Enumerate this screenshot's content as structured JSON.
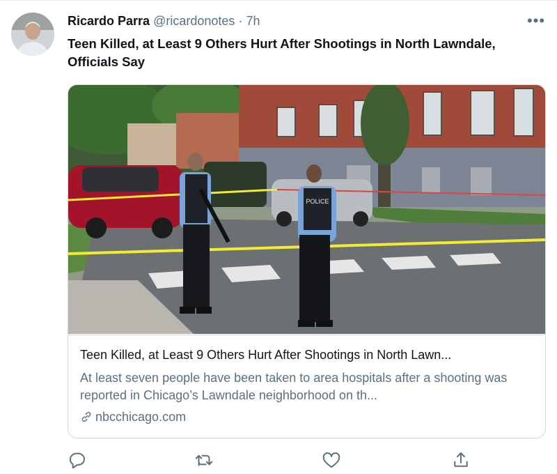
{
  "tweet": {
    "author_name": "Ricardo Parra",
    "handle": "@ricardonotes",
    "separator": "·",
    "time": "7h",
    "more_label": "•••",
    "text": "Teen Killed, at Least 9 Others Hurt After Shootings in North Lawndale, Officials Say"
  },
  "card": {
    "image_icon": "news-photo",
    "police_label": "POLICE",
    "title": "Teen Killed, at Least 9 Others Hurt After Shootings in North Lawn...",
    "description": "At least seven people have been taken to area hospitals after a shooting was reported in Chicago’s Lawndale neighborhood on th...",
    "domain": "nbcchicago.com",
    "link_icon": "link-icon"
  },
  "actions": [
    "reply-icon",
    "retweet-icon",
    "like-icon",
    "share-icon"
  ],
  "colors": {
    "secondary_text": "#5b7083",
    "border": "#cfd9de",
    "tape": "#f2ea34"
  }
}
